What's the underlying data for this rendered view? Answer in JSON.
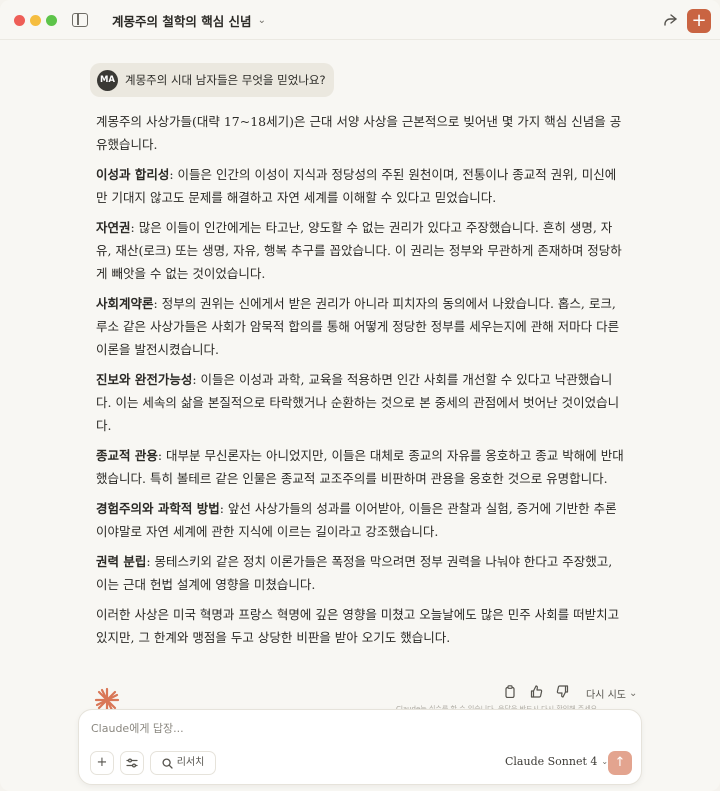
{
  "window": {
    "title": "계몽주의 철학의 핵심 신념",
    "accent_color": "#c96442"
  },
  "user_message": {
    "avatar_initials": "MA",
    "text": "계몽주의 시대 남자들은 무엇을 믿었나요?"
  },
  "response": {
    "intro": "계몽주의 사상가들(대략 17~18세기)은 근대 서양 사상을 근본적으로 빚어낸 몇 가지 핵심 신념을 공유했습니다.",
    "points": [
      {
        "term": "이성과 합리성",
        "text": ": 이들은 인간의 이성이 지식과 정당성의 주된 원천이며, 전통이나 종교적 권위, 미신에만 기대지 않고도 문제를 해결하고 자연 세계를 이해할 수 있다고 믿었습니다."
      },
      {
        "term": "자연권",
        "text": ": 많은 이들이 인간에게는 타고난, 양도할 수 없는 권리가 있다고 주장했습니다. 흔히 생명, 자유, 재산(로크) 또는 생명, 자유, 행복 추구를 꼽았습니다. 이 권리는 정부와 무관하게 존재하며 정당하게 빼앗을 수 없는 것이었습니다."
      },
      {
        "term": "사회계약론",
        "text": ": 정부의 권위는 신에게서 받은 권리가 아니라 피치자의 동의에서 나왔습니다. 홉스, 로크, 루소 같은 사상가들은 사회가 암묵적 합의를 통해 어떻게 정당한 정부를 세우는지에 관해 저마다 다른 이론을 발전시켰습니다."
      },
      {
        "term": "진보와 완전가능성",
        "text": ": 이들은 이성과 과학, 교육을 적용하면 인간 사회를 개선할 수 있다고 낙관했습니다. 이는 세속의 삶을 본질적으로 타락했거나 순환하는 것으로 본 중세의 관점에서 벗어난 것이었습니다."
      },
      {
        "term": "종교적 관용",
        "text": ": 대부분 무신론자는 아니었지만, 이들은 대체로 종교의 자유를 옹호하고 종교 박해에 반대했습니다. 특히 볼테르 같은 인물은 종교적 교조주의를 비판하며 관용을 옹호한 것으로 유명합니다."
      },
      {
        "term": "경험주의와 과학적 방법",
        "text": ": 앞선 사상가들의 성과를 이어받아, 이들은 관찰과 실험, 증거에 기반한 추론이야말로 자연 세계에 관한 지식에 이르는 길이라고 강조했습니다."
      },
      {
        "term": "권력 분립",
        "text": ": 몽테스키외 같은 정치 이론가들은 폭정을 막으려면 정부 권력을 나눠야 한다고 주장했고, 이는 근대 헌법 설계에 영향을 미쳤습니다."
      }
    ],
    "conclusion": "이러한 사상은 미국 혁명과 프랑스 혁명에 깊은 영향을 미쳤고 오늘날에도 많은 민주 사회를 떠받치고 있지만, 그 한계와 맹점을 두고 상당한 비판을 받아 오기도 했습니다."
  },
  "actions": {
    "retry_label": "다시 시도",
    "disclaimer": "Claude는 실수를 할 수 있습니다. 응답을 반드시 다시 확인해 주세요."
  },
  "composer": {
    "placeholder": "Claude에게 답장...",
    "research_label": "리서치",
    "model_label": "Claude Sonnet 4"
  }
}
